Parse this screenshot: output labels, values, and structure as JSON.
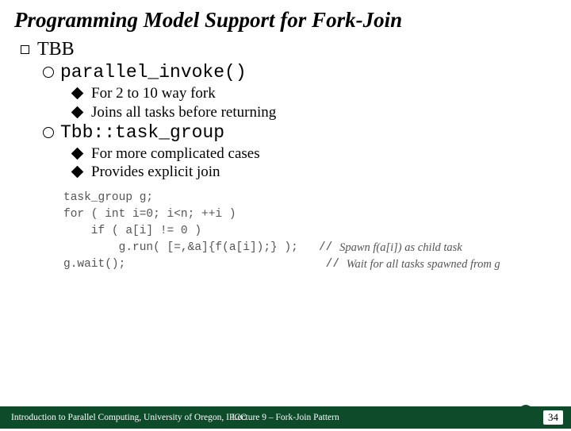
{
  "title": "Programming Model Support for Fork-Join",
  "items": {
    "tbb": "TBB",
    "parallel_invoke": "parallel_invoke()",
    "pi_sub1": "For 2 to 10 way fork",
    "pi_sub2": "Joins all tasks before returning",
    "task_group": "Tbb::task_group",
    "tg_sub1": "For more complicated cases",
    "tg_sub2": "Provides explicit join"
  },
  "code": {
    "l1": "task_group g;",
    "l2": "for ( int i=0; i<n; ++i )",
    "l3": "    if ( a[i] != 0 )",
    "l4a": "        g.run( [=,&a]{f(a[i]);} );",
    "l4b": "   // ",
    "l4c": "Spawn f(a[i]) as child task",
    "l5a": "g.wait();",
    "l5b": "                             // ",
    "l5c": "Wait for all tasks spawned from g"
  },
  "footer": {
    "left": "Introduction to Parallel Computing, University of Oregon, IPCC",
    "mid": "Lecture 9 – Fork-Join Pattern",
    "num": "34"
  }
}
